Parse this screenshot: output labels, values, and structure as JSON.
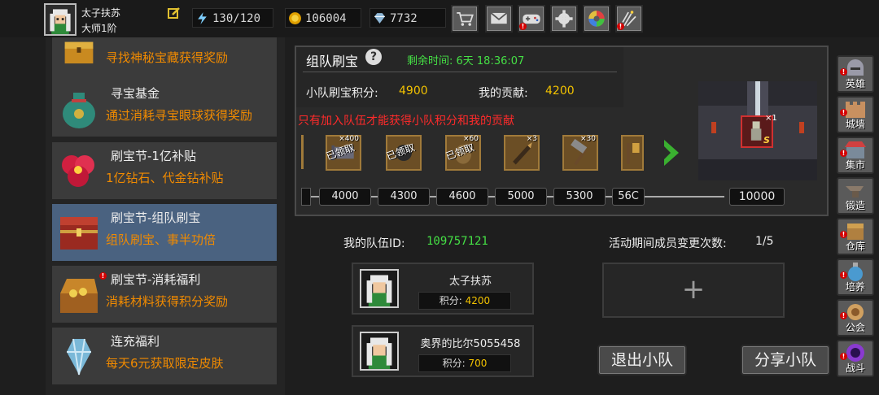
{
  "player": {
    "name": "太子扶苏",
    "rank": "大师1阶"
  },
  "stats": {
    "energy": "130/120",
    "gold": "106004",
    "gems": "7732"
  },
  "top_icons": [
    "edit-icon",
    "energy-icon",
    "gold-coin-icon",
    "gem-icon",
    "shop-cart-icon",
    "mail-icon",
    "gamepad-icon",
    "settings-gear-icon",
    "color-wheel-icon",
    "fireworks-icon"
  ],
  "left_list": [
    {
      "title": "",
      "desc": "寻找神秘宝藏获得奖励",
      "icon": "treasure-chest-icon"
    },
    {
      "title": "寻宝基金",
      "desc": "通过消耗寻宝眼球获得奖励",
      "icon": "money-bag-icon"
    },
    {
      "title": "刷宝节-1亿补贴",
      "desc": "1亿钻石、代金钻补贴",
      "icon": "red-flower-icon"
    },
    {
      "title": "刷宝节-组队刷宝",
      "desc": "组队刷宝、事半功倍",
      "icon": "red-chest-icon",
      "selected": true
    },
    {
      "title": "刷宝节-消耗福利",
      "desc": "消耗材料获得积分奖励",
      "icon": "open-treasure-icon"
    },
    {
      "title": "连充福利",
      "desc": "每天6元获取限定皮肤",
      "icon": "crystal-icon"
    }
  ],
  "event": {
    "title": "组队刷宝",
    "remaining": "剩余时间: 6天 18:36:07",
    "team_score_label": "小队刷宝积分:",
    "team_score": "4900",
    "my_contrib_label": "我的贡献:",
    "my_contrib": "4200",
    "warning": "只有加入队伍才能获得小队积分和我的贡献"
  },
  "rewards": [
    {
      "icon": "scroll-icon",
      "mult": "×400",
      "status": "已领取"
    },
    {
      "icon": "dark-orb-icon",
      "mult": "",
      "status": "已领取"
    },
    {
      "icon": "seed-icon",
      "mult": "×60",
      "status": "已领取"
    },
    {
      "icon": "bullet-icon",
      "mult": "×3",
      "status": ""
    },
    {
      "icon": "hammer-icon",
      "mult": "×30",
      "status": ""
    },
    {
      "icon": "staff-icon",
      "mult": "",
      "status": ""
    }
  ],
  "milestones": [
    "4000",
    "4300",
    "4600",
    "5000",
    "5300",
    "56C"
  ],
  "final_milestone": "10000",
  "final_reward": {
    "mult": "×1",
    "rarity": "S",
    "icon": "knight-figure-icon"
  },
  "team": {
    "id_label": "我的队伍ID:",
    "id": "109757121",
    "changes_label": "活动期间成员变更次数:",
    "changes": "1/5",
    "members": [
      {
        "name": "太子扶苏",
        "score_label": "积分:",
        "score": "4200"
      },
      {
        "name": "奥界的比尔5055458",
        "score_label": "积分:",
        "score": "700"
      }
    ],
    "add_symbol": "+",
    "leave": "退出小队",
    "share": "分享小队"
  },
  "side_menu": [
    {
      "label": "英雄",
      "icon": "helmet-icon",
      "alert": true
    },
    {
      "label": "城墙",
      "icon": "wall-icon",
      "alert": true
    },
    {
      "label": "集市",
      "icon": "market-icon",
      "alert": true
    },
    {
      "label": "锻造",
      "icon": "anvil-icon",
      "alert": false
    },
    {
      "label": "仓库",
      "icon": "warehouse-icon",
      "alert": true
    },
    {
      "label": "培养",
      "icon": "potion-icon",
      "alert": true
    },
    {
      "label": "公会",
      "icon": "guild-icon",
      "alert": true
    },
    {
      "label": "战斗",
      "icon": "portal-icon",
      "alert": true
    }
  ],
  "colors": {
    "accent_orange": "#f08a00",
    "timer_green": "#45e045",
    "gold_text": "#f2c200",
    "warning_red": "#ff2a2a",
    "selected_bg": "#4a6280"
  }
}
